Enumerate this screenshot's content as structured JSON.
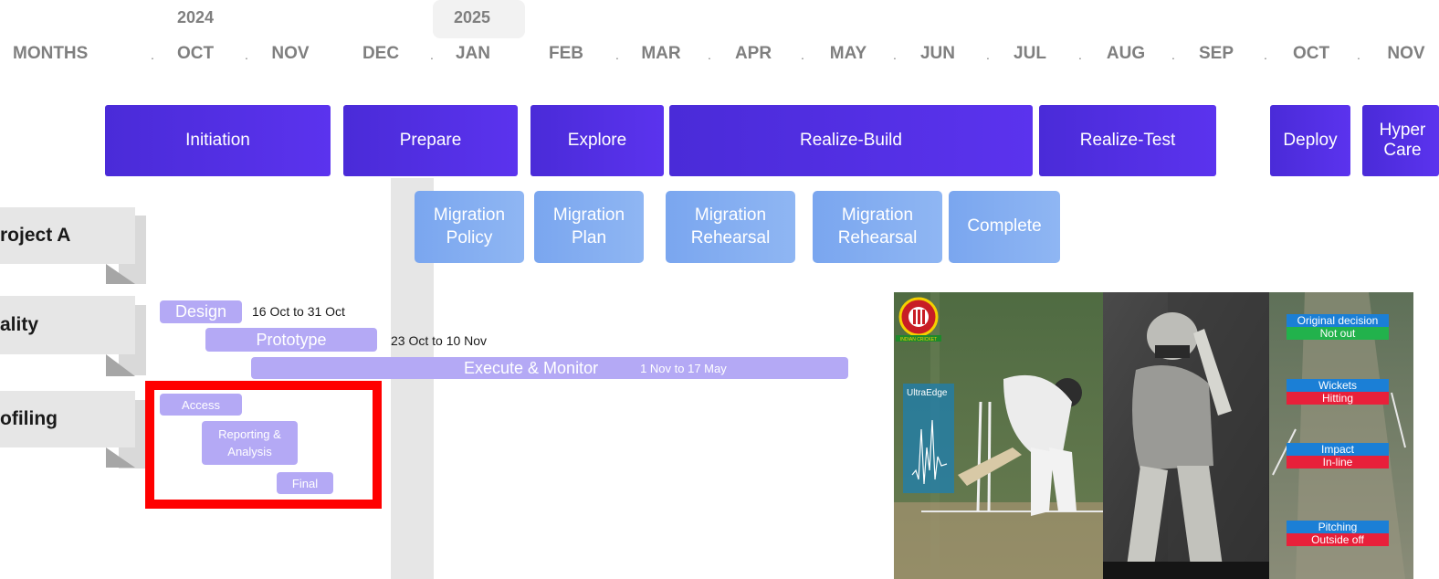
{
  "years": [
    "2024",
    "2025"
  ],
  "header_label": "MONTHS",
  "months": [
    "OCT",
    "NOV",
    "DEC",
    "JAN",
    "FEB",
    "MAR",
    "APR",
    "MAY",
    "JUN",
    "JUL",
    "AUG",
    "SEP",
    "OCT",
    "NOV"
  ],
  "phases": [
    "Initiation",
    "Prepare",
    "Explore",
    "Realize-Build",
    "Realize-Test",
    "Deploy",
    "Hyper Care"
  ],
  "migrations": [
    "Migration Policy",
    "Migration Plan",
    "Migration Rehearsal",
    "Migration Rehearsal",
    "Complete"
  ],
  "rows": [
    "roject A",
    "ality",
    "ofiling"
  ],
  "tasks": {
    "design": {
      "label": "Design",
      "dates": "16 Oct to 31 Oct"
    },
    "prototype": {
      "label": "Prototype",
      "dates": "23 Oct to 10 Nov"
    },
    "execute": {
      "label": "Execute & Monitor",
      "dates": "1 Nov to 17 May"
    },
    "access": {
      "label": "Access"
    },
    "reporting": {
      "label": "Reporting & Analysis"
    },
    "final": {
      "label": "Final"
    }
  },
  "photo": {
    "ultraedge": "UltraEdge",
    "badge_text": "INDIAN CRICKET",
    "decisions": [
      {
        "top": "Original decision",
        "bottom": "Not out",
        "bottom_color": "#22b24c"
      },
      {
        "top": "Wickets",
        "bottom": "Hitting",
        "bottom_color": "#e8203a"
      },
      {
        "top": "Impact",
        "bottom": "In-line",
        "bottom_color": "#e8203a"
      },
      {
        "top": "Pitching",
        "bottom": "Outside off",
        "bottom_color": "#e8203a"
      }
    ]
  },
  "colors": {
    "phase": "#4f2fe0",
    "migration": "#86adf1",
    "task": "#b4a9f5",
    "highlight": "#ff0000"
  }
}
